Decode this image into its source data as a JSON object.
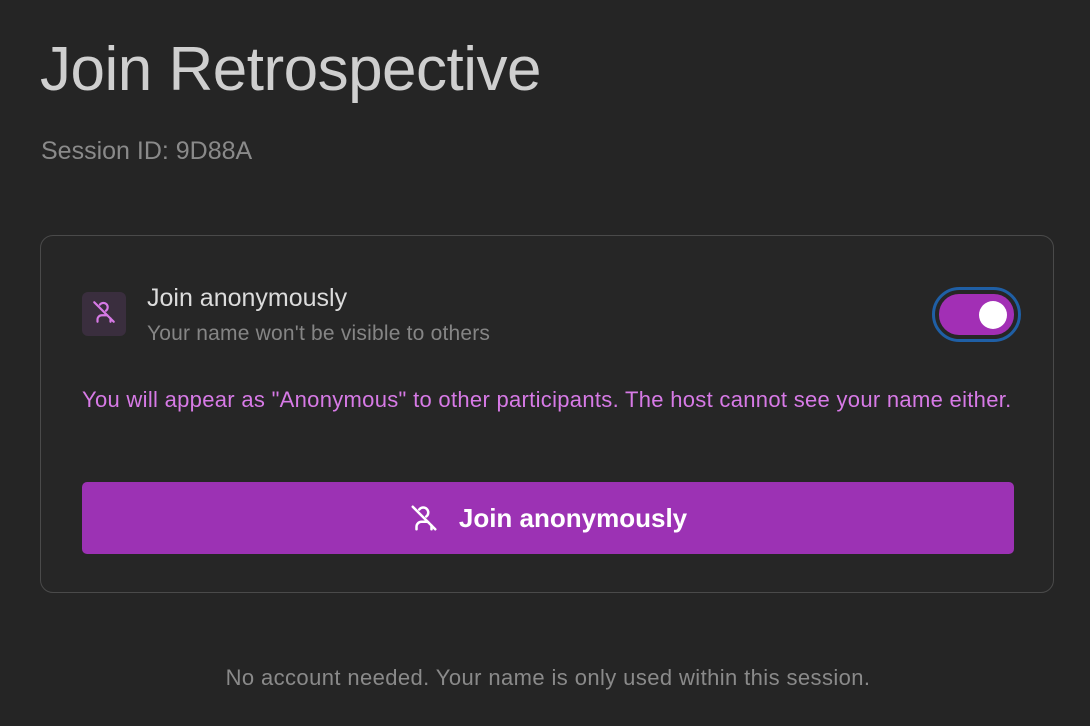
{
  "page": {
    "title": "Join Retrospective",
    "session_id": "Session ID: 9D88A"
  },
  "anonymous_option": {
    "icon": "user-off-icon",
    "title": "Join anonymously",
    "description": "Your name won't be visible to others",
    "toggle_on": true,
    "notice": "You will appear as \"Anonymous\" to other participants. The host cannot see your name either."
  },
  "join_button": {
    "icon": "user-off-icon",
    "label": "Join anonymously"
  },
  "footer": {
    "note": "No account needed. Your name is only used within this session."
  },
  "colors": {
    "background": "#252525",
    "accent": "#9c32b4",
    "notice_text": "#d77ae6",
    "focus_ring": "#1f5fa5"
  }
}
